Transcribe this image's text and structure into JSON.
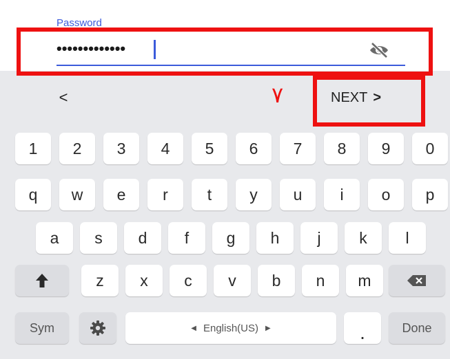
{
  "password": {
    "label": "Password",
    "masked_value": "•••••••••••••",
    "visibility_icon": "eye-slash-icon"
  },
  "annotation": {
    "step_marker": "٧",
    "highlight_color": "#ee1111"
  },
  "keyboard_nav": {
    "prev_symbol": "<",
    "next_label": "NEXT",
    "next_symbol": ">"
  },
  "keyboard": {
    "number_row": [
      "1",
      "2",
      "3",
      "4",
      "5",
      "6",
      "7",
      "8",
      "9",
      "0"
    ],
    "row1": [
      "q",
      "w",
      "e",
      "r",
      "t",
      "y",
      "u",
      "i",
      "o",
      "p"
    ],
    "row2": [
      "a",
      "s",
      "d",
      "f",
      "g",
      "h",
      "j",
      "k",
      "l"
    ],
    "row3": [
      "z",
      "x",
      "c",
      "v",
      "b",
      "n",
      "m"
    ],
    "shift_icon": "shift-arrow-icon",
    "backspace_icon": "backspace-icon",
    "sym_label": "Sym",
    "settings_icon": "gear-icon",
    "space_label": "English(US)",
    "period_label": ".",
    "done_label": "Done"
  },
  "colors": {
    "accent": "#3b5bdb",
    "keyboard_bg": "#e8e9ec",
    "key_bg": "#ffffff",
    "function_key_bg": "#dcdde1"
  }
}
